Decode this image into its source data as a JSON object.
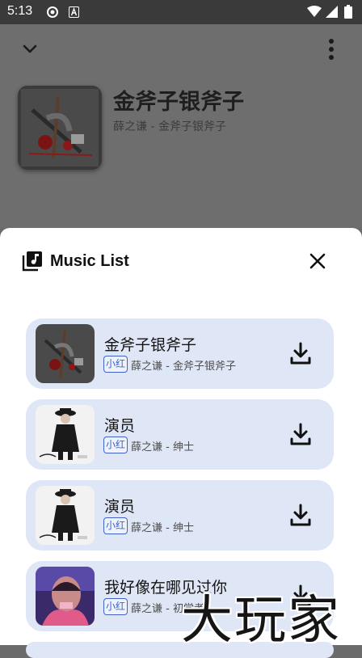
{
  "status_bar": {
    "time": "5:13"
  },
  "now_playing": {
    "title": "金斧子银斧子",
    "subtitle": "薛之谦 - 金斧子银斧子"
  },
  "sheet": {
    "title": "Music List"
  },
  "songs": [
    {
      "title": "金斧子银斧子",
      "source": "小红",
      "artist": "薛之谦 - 金斧子银斧子",
      "cover": "axe"
    },
    {
      "title": "演员",
      "source": "小红",
      "artist": "薛之谦 - 绅士",
      "cover": "gentleman"
    },
    {
      "title": "演员",
      "source": "小红",
      "artist": "薛之谦 - 绅士",
      "cover": "gentleman"
    },
    {
      "title": "我好像在哪见过你",
      "source": "小红",
      "artist": "薛之谦 - 初学者",
      "cover": "beginner"
    }
  ],
  "watermark": "大玩家",
  "colors": {
    "accent": "#3f63c9",
    "card": "#dfe6f5",
    "scrim": "#6e6e6e"
  }
}
